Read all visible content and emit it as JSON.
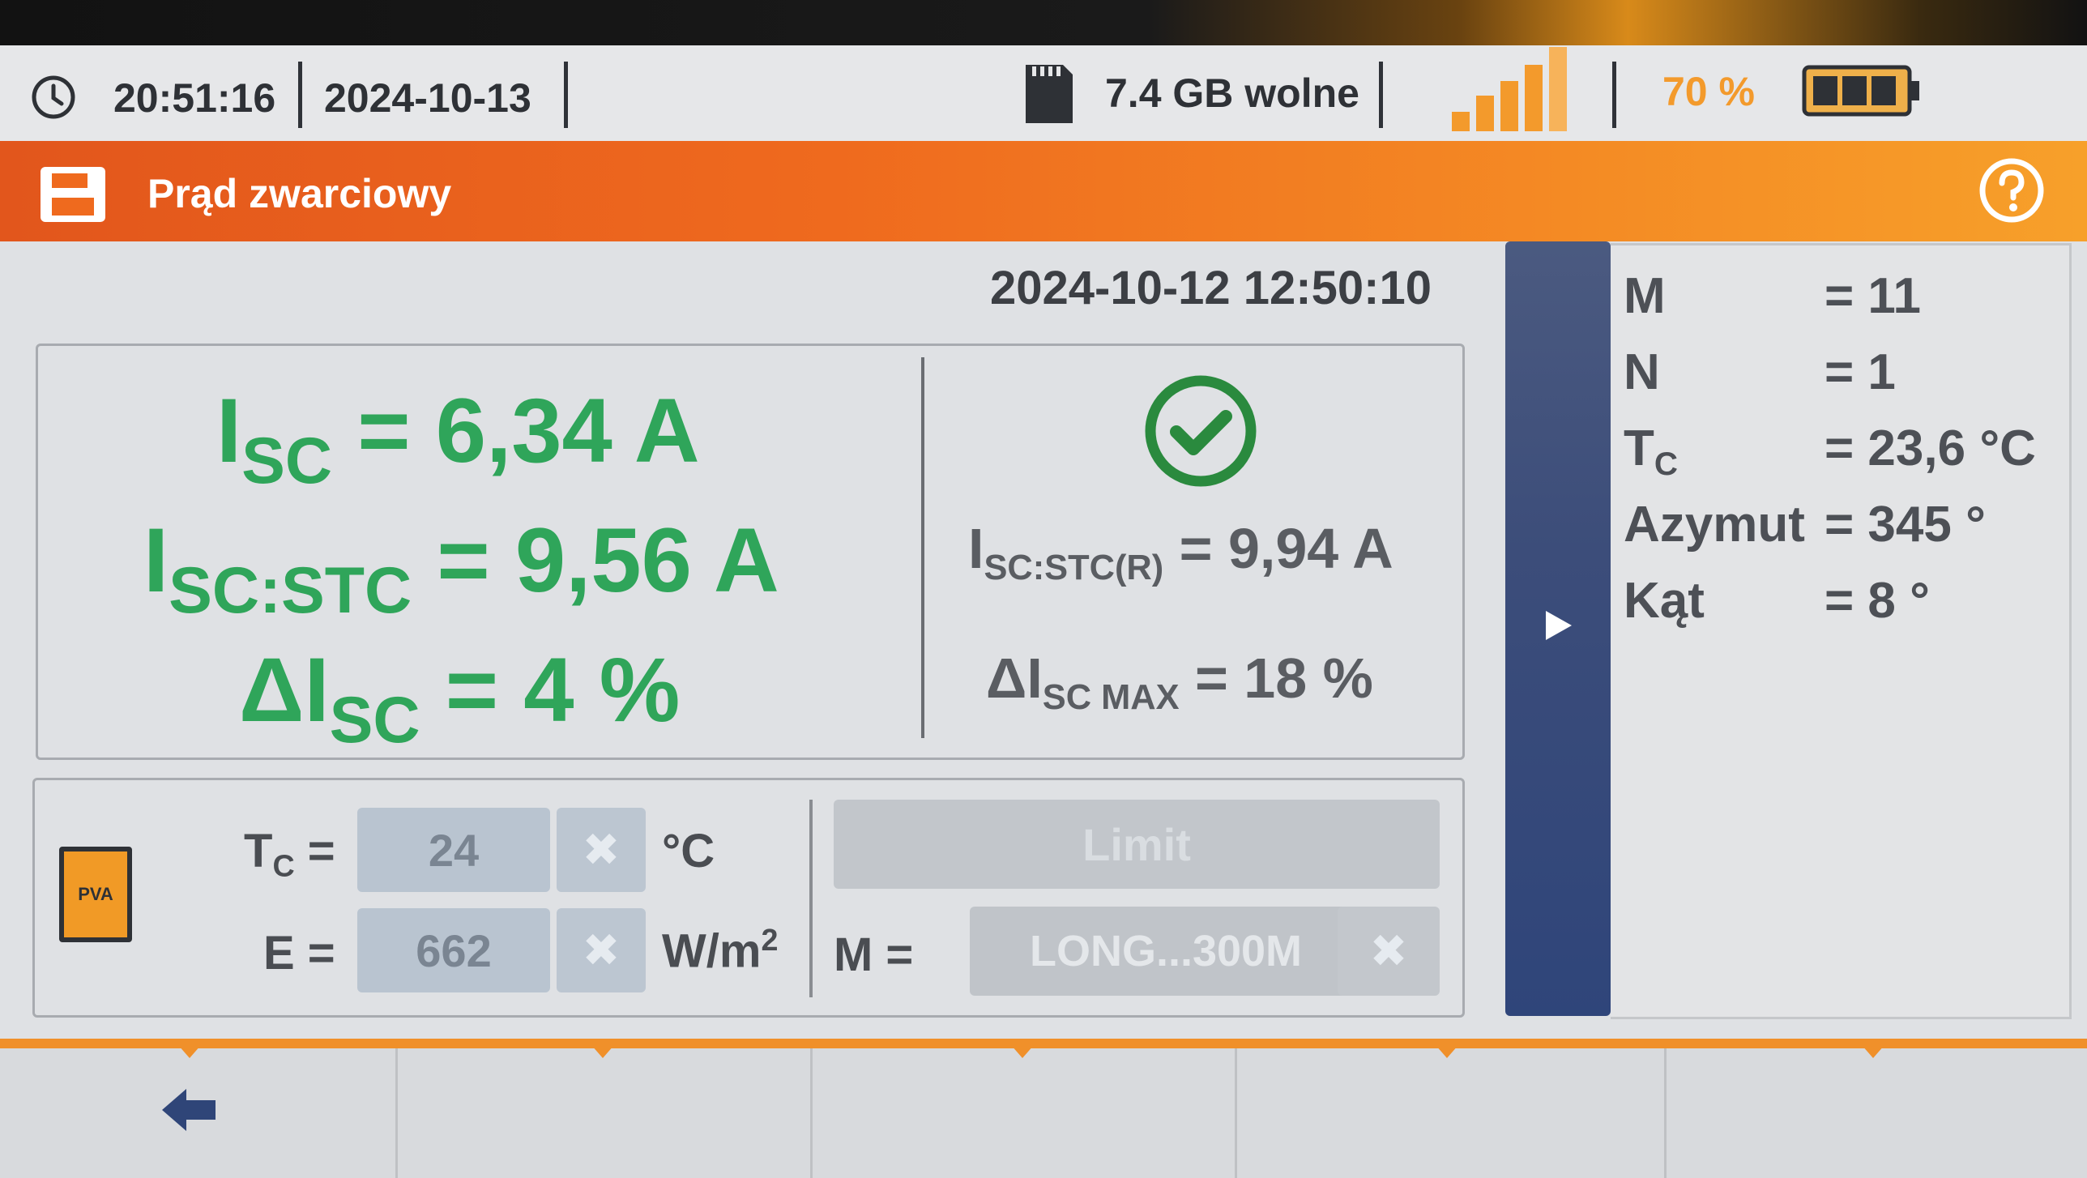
{
  "status": {
    "time": "20:51:16",
    "date": "2024-10-13",
    "storage": "7.4 GB wolne",
    "battery_percent": "70 %",
    "signal_bars_filled": 4,
    "battery_level": 0.7
  },
  "header": {
    "title": "Prąd zwarciowy"
  },
  "measurement": {
    "timestamp": "2024-10-12 12:50:10",
    "isc": {
      "label": "I",
      "sub": "SC",
      "value": "= 6,34 A"
    },
    "isc_stc": {
      "label": "I",
      "sub": "SC:STC",
      "value": "= 9,56 A"
    },
    "delta_isc": {
      "label": "ΔI",
      "sub": "SC",
      "value": "= 4 %"
    },
    "isc_stc_r": {
      "label": "I",
      "sub": "SC:STC(R)",
      "value": "= 9,94 A"
    },
    "delta_isc_max": {
      "label": "ΔI",
      "sub": "SC MAX",
      "value": "= 18 %"
    }
  },
  "settings": {
    "pva_label": "PVA",
    "tc_label": "T",
    "tc_sub": "C",
    "tc_eq": "=",
    "tc_value": "24",
    "tc_unit": "°C",
    "e_label": "E =",
    "e_value": "662",
    "e_unit": "W/m",
    "e_unit_sup": "2",
    "limit_label": "Limit",
    "m_label": "M =",
    "m_value": "LONG...300M",
    "clear_symbol": "✖"
  },
  "side_info": {
    "m_key": "M",
    "m_val": "= 11",
    "n_key": "N",
    "n_val": "= 1",
    "tc_key": "T",
    "tc_sub": "C",
    "tc_val": "= 23,6 °C",
    "azimuth_key": "Azymut",
    "azimuth_val": "= 345 °",
    "angle_key": "Kąt",
    "angle_val": "= 8 °"
  },
  "colors": {
    "accent_orange": "#ef6a1e",
    "result_green": "#2fa55a",
    "side_blue": "#3c4d7a"
  }
}
